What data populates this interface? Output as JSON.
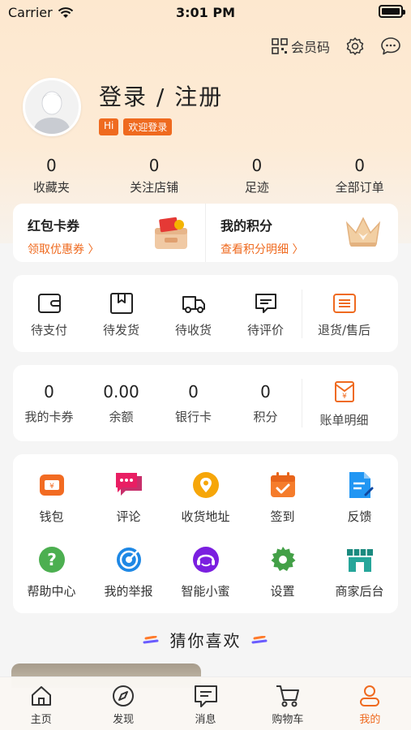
{
  "status_bar": {
    "carrier": "Carrier",
    "time": "3:01 PM"
  },
  "header": {
    "member_code": "会员码"
  },
  "profile": {
    "title": "登录 / 注册",
    "tags": [
      "Hi",
      "欢迎登录"
    ]
  },
  "stats": [
    {
      "value": "0",
      "label": "收藏夹"
    },
    {
      "value": "0",
      "label": "关注店铺"
    },
    {
      "value": "0",
      "label": "足迹"
    },
    {
      "value": "0",
      "label": "全部订单"
    }
  ],
  "promo": {
    "coupon": {
      "title": "红包卡券",
      "link": "领取优惠券 〉"
    },
    "points": {
      "title": "我的积分",
      "link": "查看积分明细 〉"
    }
  },
  "orders": [
    "待支付",
    "待发货",
    "待收货",
    "待评价",
    "退货/售后"
  ],
  "wallet": [
    {
      "value": "0",
      "label": "我的卡券"
    },
    {
      "value": "0.00",
      "label": "余额"
    },
    {
      "value": "0",
      "label": "银行卡"
    },
    {
      "value": "0",
      "label": "积分"
    }
  ],
  "wallet_bill": "账单明细",
  "tools": [
    "钱包",
    "评论",
    "收货地址",
    "签到",
    "反馈",
    "帮助中心",
    "我的举报",
    "智能小蜜",
    "设置",
    "商家后台"
  ],
  "guess_title": "猜你喜欢",
  "tabbar": [
    {
      "label": "主页",
      "icon": "home-icon"
    },
    {
      "label": "发现",
      "icon": "compass-icon"
    },
    {
      "label": "消息",
      "icon": "message-icon"
    },
    {
      "label": "购物车",
      "icon": "cart-icon"
    },
    {
      "label": "我的",
      "icon": "user-icon",
      "active": true
    }
  ],
  "colors": {
    "accent": "#ef6a1f",
    "hero_bg": "#fde8cf"
  }
}
